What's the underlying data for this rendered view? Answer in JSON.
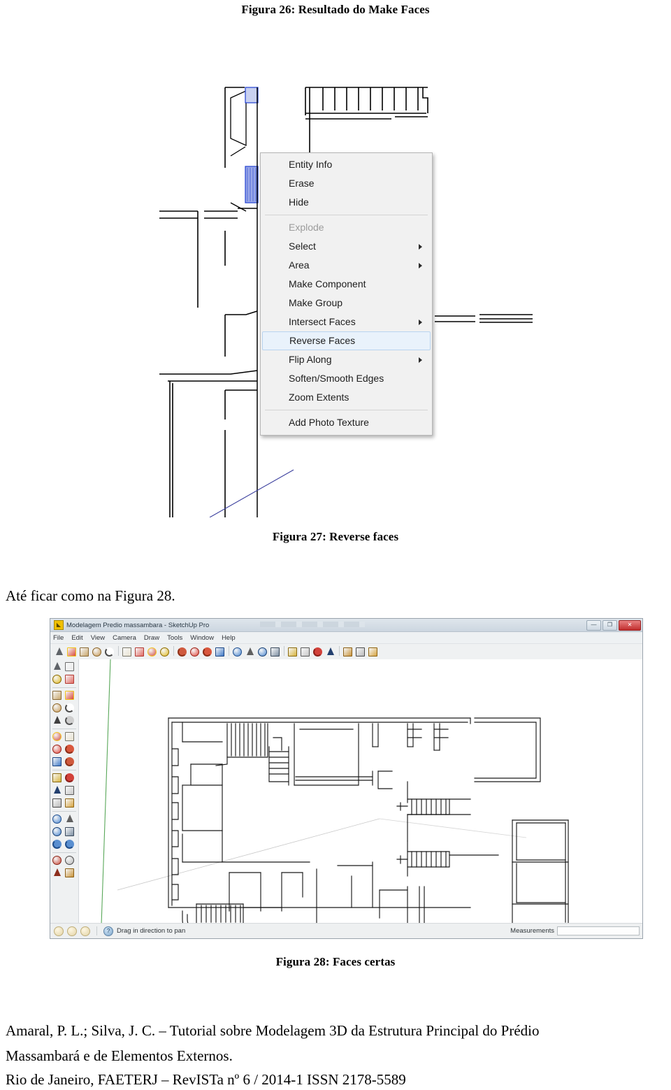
{
  "document": {
    "figure26_caption": "Figura 26: Resultado do Make Faces",
    "figure27_caption": "Figura 27: Reverse faces",
    "figure28_caption": "Figura 28: Faces certas",
    "body_text": "Até ficar como na Figura 28."
  },
  "context_menu": {
    "items": [
      {
        "label": "Entity Info",
        "disabled": false,
        "submenu": false,
        "selected": false
      },
      {
        "label": "Erase",
        "disabled": false,
        "submenu": false,
        "selected": false
      },
      {
        "label": "Hide",
        "disabled": false,
        "submenu": false,
        "selected": false
      },
      {
        "separator": true
      },
      {
        "label": "Explode",
        "disabled": true,
        "submenu": false,
        "selected": false
      },
      {
        "label": "Select",
        "disabled": false,
        "submenu": true,
        "selected": false
      },
      {
        "label": "Area",
        "disabled": false,
        "submenu": true,
        "selected": false
      },
      {
        "label": "Make Component",
        "disabled": false,
        "submenu": false,
        "selected": false
      },
      {
        "label": "Make Group",
        "disabled": false,
        "submenu": false,
        "selected": false
      },
      {
        "label": "Intersect Faces",
        "disabled": false,
        "submenu": true,
        "selected": false
      },
      {
        "label": "Reverse Faces",
        "disabled": false,
        "submenu": false,
        "selected": true
      },
      {
        "label": "Flip Along",
        "disabled": false,
        "submenu": true,
        "selected": false
      },
      {
        "label": "Soften/Smooth Edges",
        "disabled": false,
        "submenu": false,
        "selected": false
      },
      {
        "label": "Zoom Extents",
        "disabled": false,
        "submenu": false,
        "selected": false
      },
      {
        "separator": true
      },
      {
        "label": "Add Photo Texture",
        "disabled": false,
        "submenu": false,
        "selected": false
      }
    ]
  },
  "sketchup": {
    "title": "Modelagem Predio massambara - SketchUp Pro",
    "app_icon": "sketchup-icon",
    "window_buttons": [
      {
        "name": "minimize-button",
        "glyph": "—"
      },
      {
        "name": "maximize-button",
        "glyph": "❐"
      },
      {
        "name": "close-button",
        "glyph": "✕"
      }
    ],
    "menus": [
      "File",
      "Edit",
      "View",
      "Camera",
      "Draw",
      "Tools",
      "Window",
      "Help"
    ],
    "toolbar_icons": [
      "select-arrow-icon",
      "line-pencil-icon",
      "rectangle-icon",
      "circle-icon",
      "arc-icon",
      "sep",
      "push-pull-icon",
      "eraser-icon",
      "move-icon",
      "paint-bucket-icon",
      "sep",
      "offset-icon",
      "rotate-red-icon",
      "follow-me-icon",
      "scale-icon",
      "sep",
      "orbit-icon",
      "pan-icon",
      "zoom-icon",
      "zoom-extents-icon",
      "sep",
      "tape-measure-icon",
      "dimension-icon",
      "protractor-icon",
      "axes-icon",
      "sep",
      "section-plane-icon",
      "text-icon",
      "3d-text-icon"
    ],
    "left_toolbar_icons": [
      "select-arrow-icon",
      "make-component-icon",
      "paint-bucket-icon",
      "eraser-icon",
      "sep",
      "rectangle-icon",
      "line-pencil-icon",
      "circle-icon",
      "arc-icon",
      "polygon-icon",
      "freehand-icon",
      "sep",
      "move-icon",
      "push-pull-icon",
      "rotate-icon",
      "follow-me-icon",
      "scale-icon",
      "offset-icon",
      "sep",
      "tape-measure-icon",
      "protractor-icon",
      "axes-icon",
      "dimension-icon",
      "text-icon",
      "3d-text-icon",
      "sep",
      "orbit-icon",
      "pan-icon",
      "zoom-icon",
      "zoom-extents-icon",
      "previous-view-icon",
      "next-view-icon",
      "sep",
      "position-camera-icon",
      "look-around-icon",
      "walk-icon",
      "section-plane-icon"
    ],
    "statusbar": {
      "status_text": "Drag in direction to pan",
      "measurements_label": "Measurements",
      "measurements_value": "",
      "help_icon": "question-icon",
      "circles": [
        "circle-indicator-1",
        "circle-indicator-2",
        "circle-indicator-3"
      ]
    }
  },
  "footer": {
    "line1": "Amaral, P. L.; Silva, J. C. – Tutorial sobre Modelagem 3D da Estrutura Principal do Prédio",
    "line2": "Massambará e de Elementos Externos.",
    "line3": "Rio de Janeiro, FAETERJ – RevISTa nº 6 / 2014-1 ISSN 2178-5589"
  },
  "colors": {
    "selection_blue": "#1f3fd0",
    "menu_highlight": "#e9f2fb",
    "green_axis": "#5aa85a",
    "cad_line": "#000000"
  }
}
